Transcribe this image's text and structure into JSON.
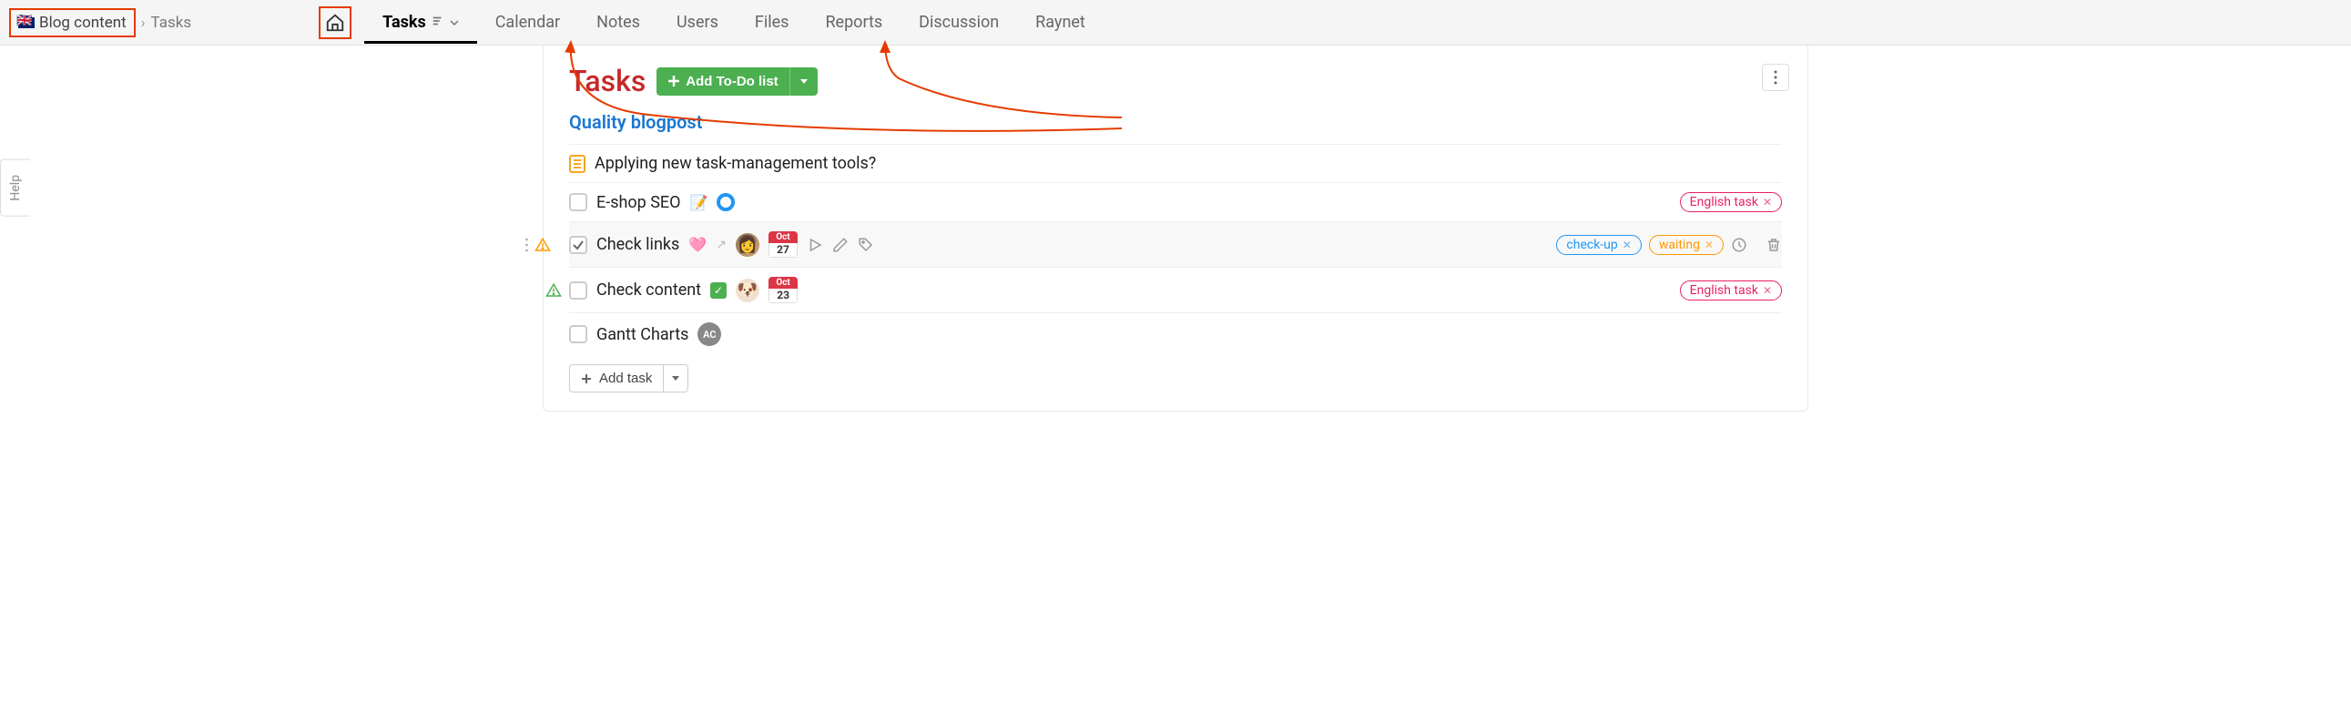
{
  "breadcrumb": {
    "project": "Blog content",
    "current": "Tasks"
  },
  "nav": {
    "tabs": [
      "Tasks",
      "Calendar",
      "Notes",
      "Users",
      "Files",
      "Reports",
      "Discussion",
      "Raynet"
    ],
    "active": "Tasks"
  },
  "help_label": "Help",
  "page": {
    "title": "Tasks",
    "add_todo_label": "Add To-Do list"
  },
  "todo_list": {
    "title": "Quality blogpost"
  },
  "tasks": [
    {
      "title": "Applying new task-management tools?",
      "has_note": true
    },
    {
      "title": "E-shop SEO",
      "emoji": "📝",
      "spinner": true,
      "tags": [
        {
          "label": "English task",
          "color": "pink"
        }
      ]
    },
    {
      "title": "Check links",
      "checked": true,
      "priority": "medium",
      "pink_attach": true,
      "link_out": true,
      "avatar": "person",
      "date": {
        "month": "Oct",
        "day": "27"
      },
      "actions": true,
      "tags": [
        {
          "label": "check-up",
          "color": "blue"
        },
        {
          "label": "waiting",
          "color": "orange"
        }
      ],
      "hovered": true,
      "clock": true,
      "trash": true,
      "drag": true
    },
    {
      "title": "Check content",
      "priority": "high",
      "green_check": true,
      "avatar": "dog",
      "date": {
        "month": "Oct",
        "day": "23"
      },
      "tags": [
        {
          "label": "English task",
          "color": "pink"
        }
      ]
    },
    {
      "title": "Gantt Charts",
      "avatar_initials": "AC"
    }
  ],
  "add_task_label": "Add task"
}
